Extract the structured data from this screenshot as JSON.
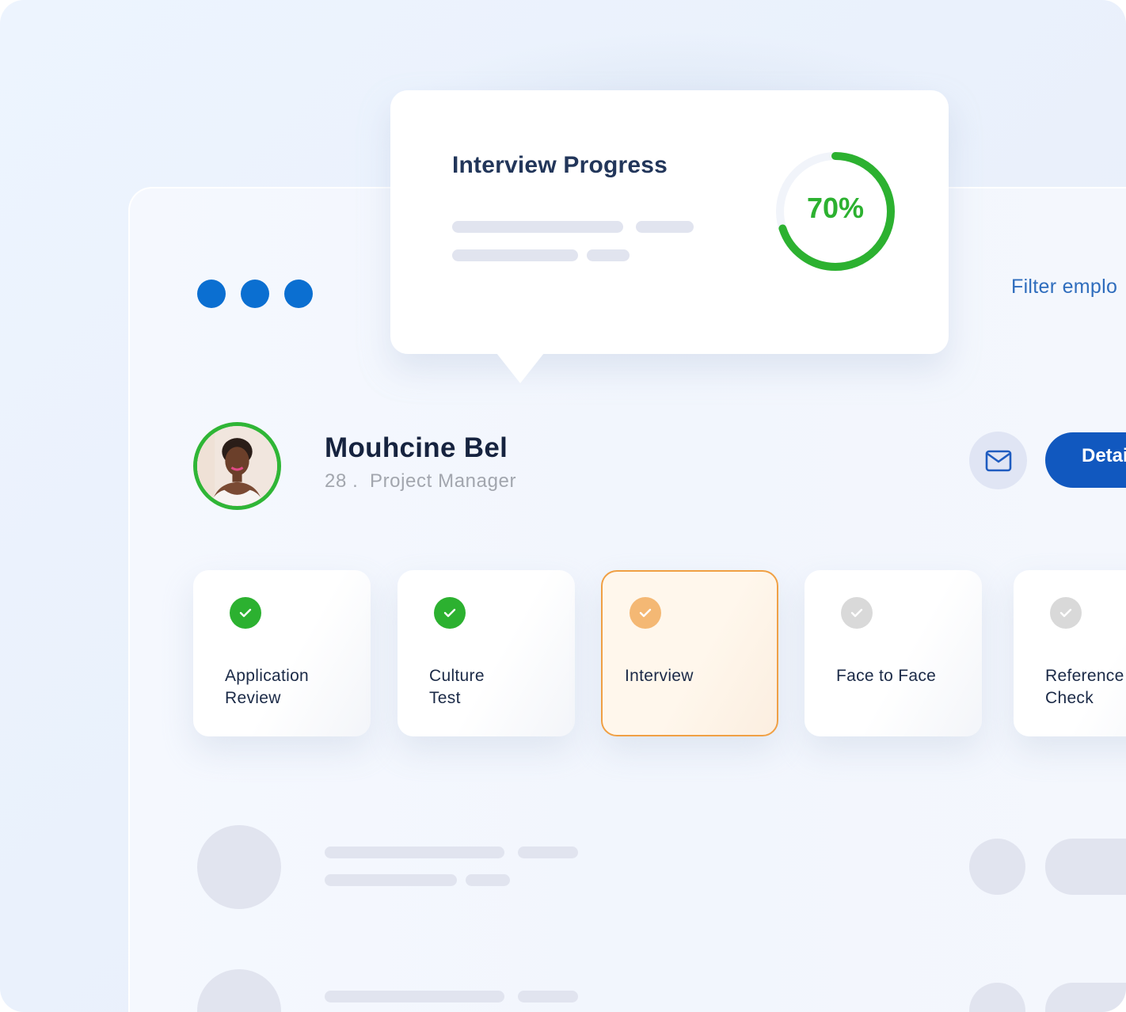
{
  "header": {
    "menu_dots_icon": "more-dots-icon",
    "filter_link": "Filter emplo"
  },
  "popover": {
    "title": "Interview Progress",
    "progress_percent": 70,
    "progress_label": "70%",
    "colors": {
      "progress": "#2cb130",
      "track": "#f1f4fa"
    }
  },
  "candidate": {
    "name": "Mouhcine Bel",
    "subtitle": "28 .  Project Manager",
    "avatar_icon": "person-photo",
    "mail_icon": "mail-icon",
    "details_button": "Details"
  },
  "steps": [
    {
      "label": "Application\nReview",
      "line1": "Application",
      "line2": "Review",
      "status": "completed",
      "color": "#2cb130"
    },
    {
      "label": "Culture\nTest",
      "line1": "Culture",
      "line2": "Test",
      "status": "completed",
      "color": "#2cb130"
    },
    {
      "label": "Interview",
      "line1": "Interview",
      "line2": "",
      "status": "in-progress",
      "color": "#f4b874"
    },
    {
      "label": "Face to Face",
      "line1": "Face to Face",
      "line2": "",
      "status": "pending",
      "color": "#d9d9d9"
    },
    {
      "label": "Reference\nCheck",
      "line1": "Reference",
      "line2": "Check",
      "status": "pending",
      "color": "#d9d9d9"
    }
  ],
  "colors": {
    "accent_blue": "#1158bf",
    "dot_blue": "#0b6fd1",
    "active_border": "#f0a044",
    "placeholder": "#e1e4ef"
  }
}
